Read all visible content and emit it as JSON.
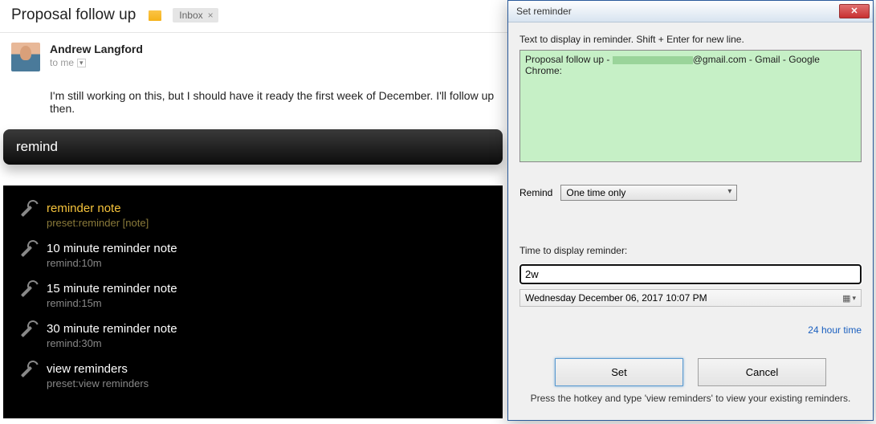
{
  "email": {
    "subject": "Proposal follow up",
    "label": "Inbox",
    "sender": "Andrew Langford",
    "to": "to me",
    "body": "I'm still working on this, but I should have it ready the first week of December. I'll follow up then."
  },
  "search": {
    "query": "remind"
  },
  "suggestions": [
    {
      "title": "reminder note",
      "sub": "preset:reminder [note]",
      "selected": true
    },
    {
      "title": "10 minute reminder note",
      "sub": "remind:10m"
    },
    {
      "title": "15 minute reminder note",
      "sub": "remind:15m"
    },
    {
      "title": "30 minute reminder note",
      "sub": "remind:30m"
    },
    {
      "title": "view reminders",
      "sub": "preset:view reminders"
    }
  ],
  "dialog": {
    "title": "Set reminder",
    "text_label": "Text to display in reminder. Shift + Enter for new line.",
    "note_prefix": "Proposal follow up - ",
    "note_suffix": "@gmail.com - Gmail - Google Chrome:",
    "remind_label": "Remind",
    "remind_value": "One time only",
    "time_label": "Time to display reminder:",
    "time_value": "2w",
    "date_display": "Wednesday December 06, 2017 10:07 PM",
    "link24": "24 hour time",
    "set": "Set",
    "cancel": "Cancel",
    "footer": "Press the hotkey and type 'view reminders' to view your existing reminders."
  }
}
